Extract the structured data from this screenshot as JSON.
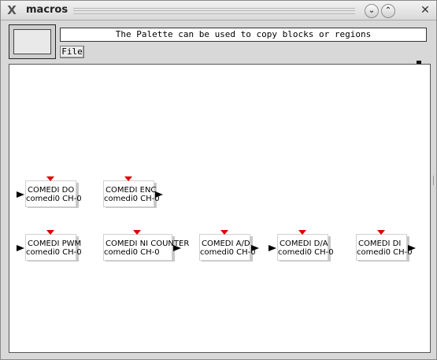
{
  "window": {
    "title": "macros",
    "app_icon": "x-logo-icon",
    "buttons": [
      "minimize-icon",
      "maximize-icon",
      "close-icon"
    ],
    "minimize_glyph": "⌄",
    "maximize_glyph": "⌃",
    "close_glyph": "✕",
    "app_glyph": "X"
  },
  "toolbar": {
    "status_text": "The Palette can be used to copy blocks or regions",
    "file_label": "File"
  },
  "blocks": [
    {
      "name": "COMEDI DO",
      "sub": "comedi0 CH-0",
      "ports": [
        "in"
      ]
    },
    {
      "name": "COMEDI ENC",
      "sub": "comedi0 CH-0",
      "ports": [
        "out"
      ]
    },
    {
      "name": "COMEDI PWM",
      "sub": "comedi0 CH-0",
      "ports": [
        "in"
      ]
    },
    {
      "name": "COMEDI NI COUNTER",
      "sub": "comedi0 CH-0",
      "ports": [
        "out"
      ]
    },
    {
      "name": "COMEDI A/D",
      "sub": "comedi0 CH-0",
      "ports": [
        "out"
      ]
    },
    {
      "name": "COMEDI D/A",
      "sub": "comedi0 CH-0",
      "ports": [
        "in"
      ]
    },
    {
      "name": "COMEDI DI",
      "sub": "comedi0 CH-0",
      "ports": [
        "out"
      ]
    }
  ],
  "colors": {
    "event_port": "#e00000",
    "io_port": "#000000"
  }
}
